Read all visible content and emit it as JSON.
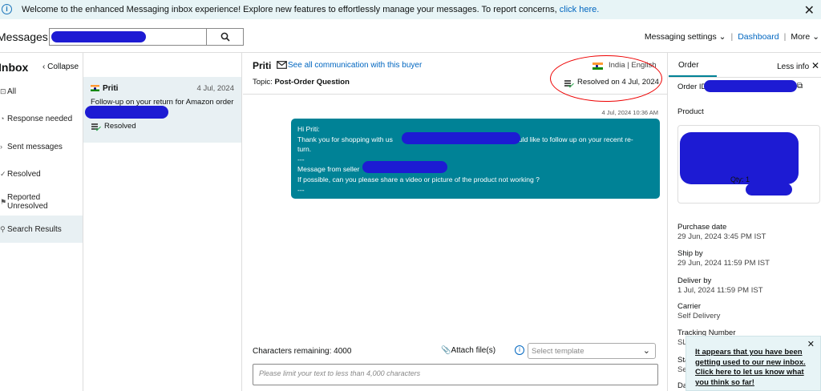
{
  "banner": {
    "icon": "info-icon",
    "text": "Welcome to the enhanced Messaging inbox experience! Explore new features to effortlessly manage your messages. To report concerns,",
    "link": "click here.",
    "close": "✕"
  },
  "header": {
    "title": "Messages",
    "search_placeholder": "",
    "nav": {
      "settings": "Messaging settings",
      "dashboard": "Dashboard",
      "more": "More",
      "sep": "|"
    }
  },
  "leftnav": {
    "title": "Inbox",
    "collapse": "Collapse",
    "items": [
      {
        "label": "All",
        "icon": "all-icon"
      },
      {
        "label": "Response needed",
        "icon": "alarm-icon"
      },
      {
        "label": "Sent messages",
        "icon": "send-icon"
      },
      {
        "label": "Resolved",
        "icon": "check-icon"
      },
      {
        "label": "Reported Unresolved",
        "icon": "flag-icon"
      },
      {
        "label": "Search Results",
        "icon": "search-icon"
      }
    ]
  },
  "conversation_list": [
    {
      "name": "Priti",
      "date": "4 Jul, 2024",
      "preview": "Follow-up on your return for Amazon order",
      "status": "Resolved"
    }
  ],
  "thread": {
    "buyer_name": "Priti",
    "see_all": "See all communication with this buyer",
    "topic_label": "Topic:",
    "topic": "Post-Order Question",
    "country": "India",
    "sep": "|",
    "language": "English",
    "resolved": "Resolved on 4 Jul, 2024",
    "message_time": "4 Jul, 2024 10:36 AM",
    "message": {
      "line1": "Hi Priti:",
      "line2a": "Thank you for shopping with us",
      "line2b": "would like to follow up on your recent re-",
      "line3": "turn.",
      "line4": "---",
      "line5": "Message from seller",
      "line6": "If possible, can you please share a video or picture of the product not working ?",
      "line7": "---"
    }
  },
  "composer": {
    "chars_label": "Characters remaining: 4000",
    "attach": "Attach file(s)",
    "template_placeholder": "Select template",
    "placeholder": "Please limit your text to less than 4,000 characters"
  },
  "right_panel": {
    "tab_order": "Order",
    "less_info": "Less info",
    "order_id_label": "Order ID",
    "product_label": "Product",
    "qty": "Qty: 1",
    "details": [
      {
        "label": "Purchase date",
        "value": "29 Jun, 2024 3:45 PM IST"
      },
      {
        "label": "Ship by",
        "value": "29 Jun, 2024 11:59 PM IST"
      },
      {
        "label": "Deliver by",
        "value": "1 Jul, 2024 11:59 PM IST"
      },
      {
        "label": "Carrier",
        "value": "Self Delivery"
      },
      {
        "label": "Tracking Number",
        "value": "SL"
      }
    ],
    "partial_label_1": "Sta",
    "partial_value_1": "Se",
    "partial_label_2": "Da"
  },
  "toast": {
    "text": "It appears that you have been getting used to our new inbox. Click here to let us know what you think so far!",
    "close": "✕"
  },
  "colors": {
    "accent": "#008296",
    "link": "#0066c0",
    "redaction": "#1d1bd3",
    "annotation": "#e00000"
  }
}
